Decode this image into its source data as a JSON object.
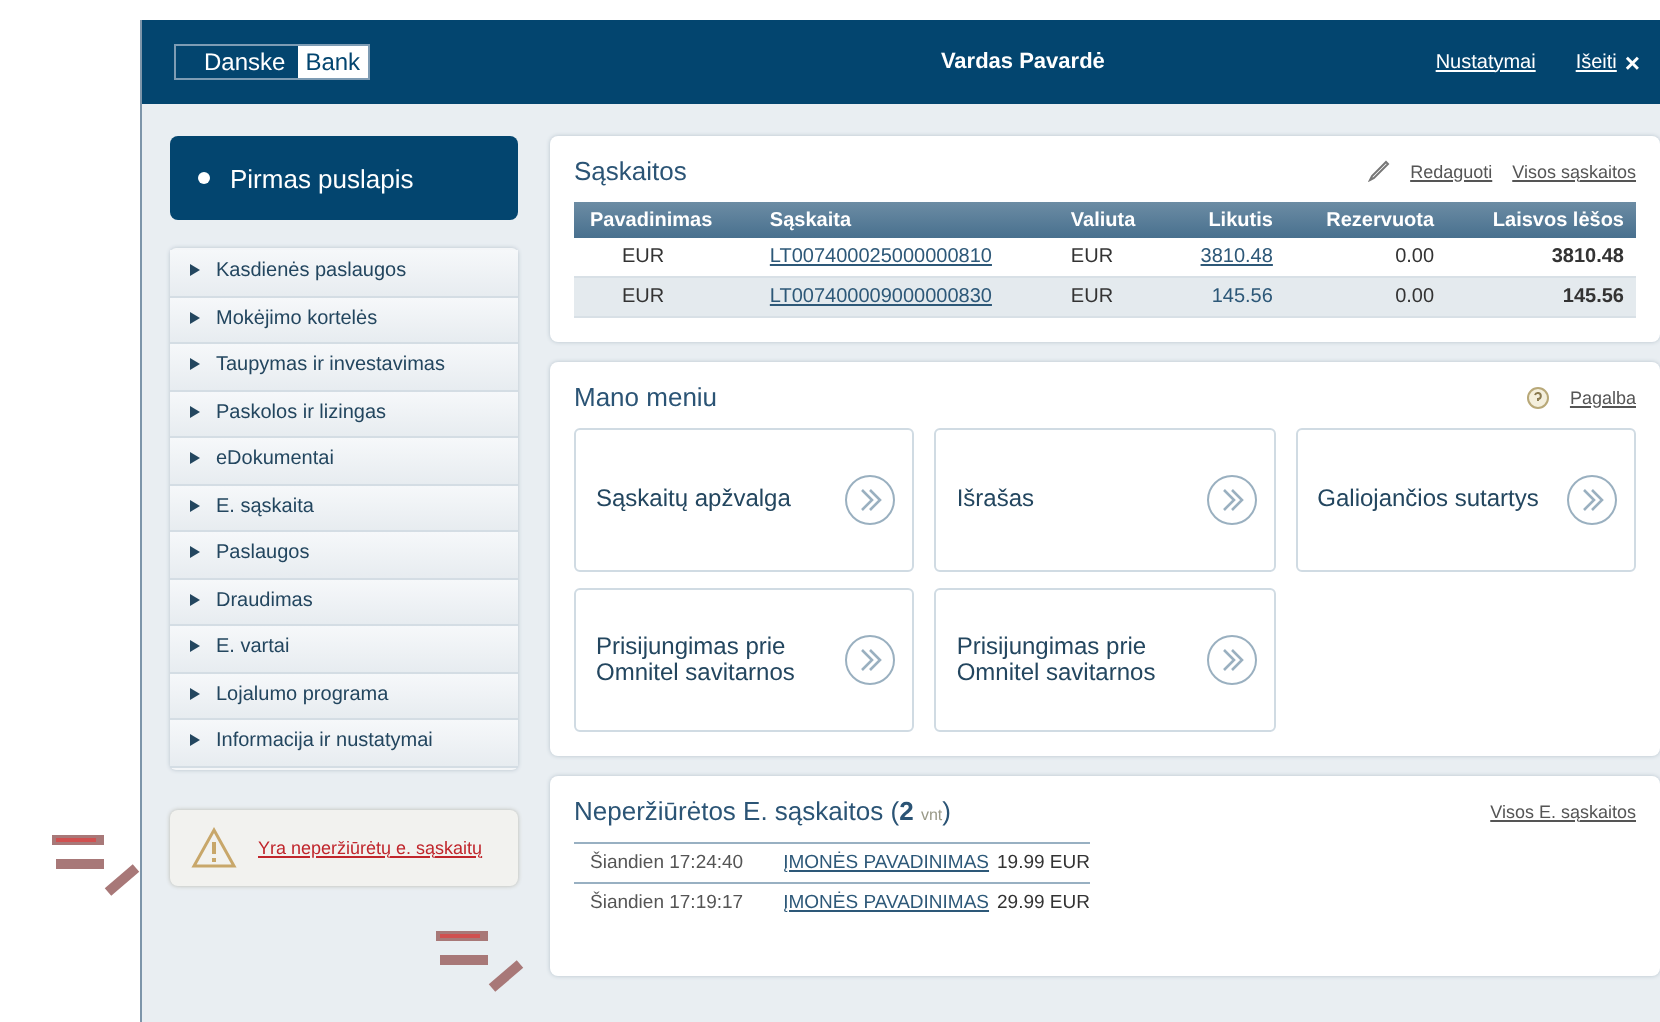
{
  "header": {
    "logo": [
      "Danske",
      "Bank"
    ],
    "user": "Vardas Pavardė",
    "links": [
      "Nustatymai",
      "Išeiti"
    ],
    "close": "×"
  },
  "sidebar": {
    "home": "Pirmas puslapis",
    "items": [
      "Kasdienės paslaugos",
      "Mokėjimo kortelės",
      "Taupymas ir investavimas",
      "Paskolos ir lizingas",
      "eDokumentai",
      "E. sąskaita",
      "Paslaugos",
      "Draudimas",
      "E. vartai",
      "Lojalumo programa",
      "Informacija ir nustatymai"
    ],
    "warning": "Yra neperžiūrėtų e. sąskaitų"
  },
  "accounts": {
    "title": "Sąskaitos",
    "edit": "Redaguoti",
    "all": "Visos sąskaitos",
    "columns": [
      "Pavadinimas",
      "Sąskaita",
      "Valiuta",
      "Likutis",
      "Rezervuota",
      "Laisvos lėšos"
    ],
    "rows": [
      [
        "EUR",
        "LT007400025000000810",
        "EUR",
        "3810.48",
        "0.00",
        "3810.48"
      ],
      [
        "EUR",
        "LT007400009000000830",
        "EUR",
        "145.56",
        "0.00",
        "145.56"
      ]
    ]
  },
  "my_menu": {
    "title": "Mano meniu",
    "help": "Pagalba",
    "tiles": [
      "Sąskaitų apžvalga",
      "Išrašas",
      "Galiojančios sutartys",
      "Prisijungimas prie Omnitel savitarnos",
      "Prisijungimas prie Omnitel savitarnos"
    ]
  },
  "einvoices": {
    "title": "Neperžiūrėtos E. sąskaitos (",
    "count": "2",
    "unit": "vnt",
    "close_paren": ")",
    "all": "Visos E. sąskaitos",
    "rows": [
      [
        "Šiandien 17:24:40",
        "ĮMONĖS PAVADINIMAS",
        "19.99 EUR"
      ],
      [
        "Šiandien 17:19:17",
        "ĮMONĖS PAVADINIMAS",
        "29.99 EUR"
      ]
    ]
  }
}
